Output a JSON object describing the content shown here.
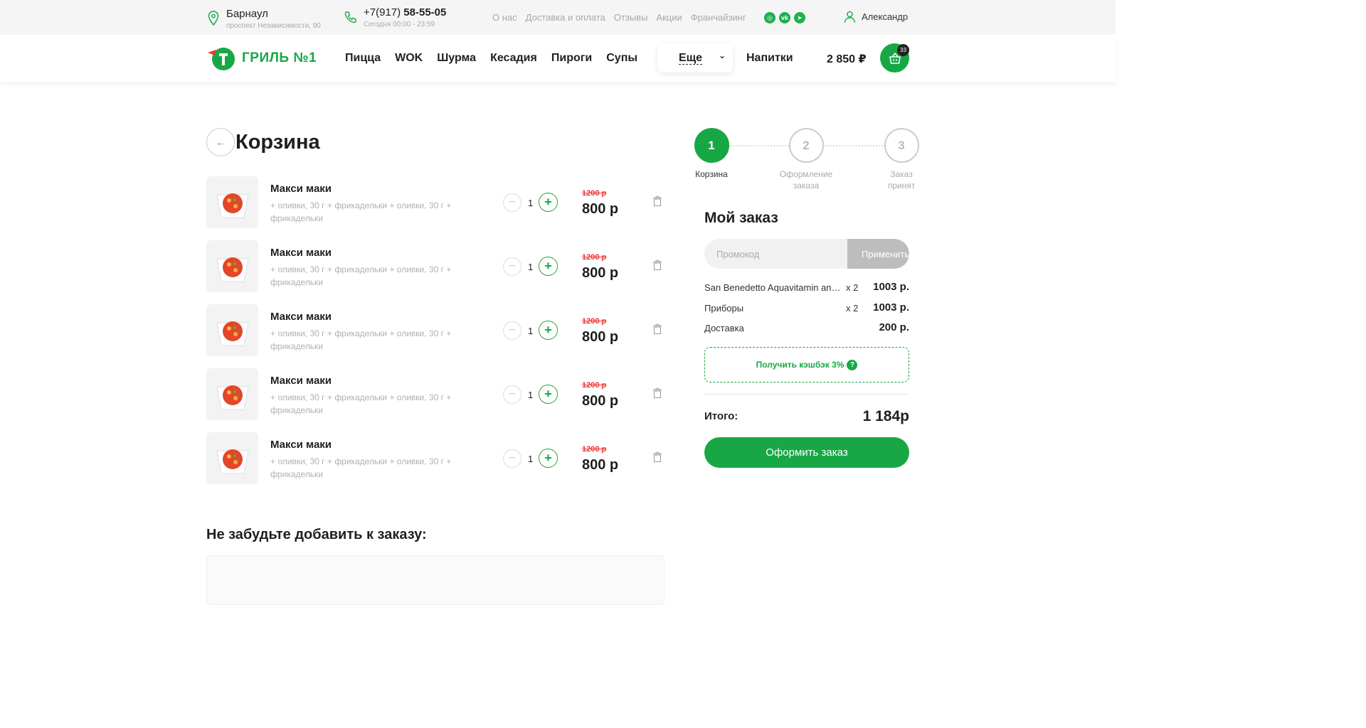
{
  "topbar": {
    "city": "Барнаул",
    "address": "проспект Независимости, 90",
    "phone_prefix": "+7(917) ",
    "phone_main": "58-55-05",
    "hours": "Сегодня 00:00 - 23:59",
    "links": [
      "О нас",
      "Доставка и оплата",
      "Отзывы",
      "Акции",
      "Франчайзинг"
    ],
    "user_name": "Александр"
  },
  "header": {
    "logo_text": "ГРИЛЬ №1",
    "nav": [
      "Пицца",
      "WOK",
      "Шурма",
      "Кесадия",
      "Пироги",
      "Супы"
    ],
    "more_label": "Еще",
    "drinks_label": "Напитки",
    "cart_total": "2 850 ₽",
    "cart_count": "33",
    "accent": "#17a845"
  },
  "cart": {
    "title": "Корзина",
    "items": [
      {
        "name": "Макси маки",
        "desc": "+ оливки, 30 г + фрикадельки + оливки, 30 г + фрикадельки",
        "qty": "1",
        "old_price": "1200 р",
        "price": "800 р"
      },
      {
        "name": "Макси маки",
        "desc": "+ оливки, 30 г + фрикадельки + оливки, 30 г + фрикадельки",
        "qty": "1",
        "old_price": "1200 р",
        "price": "800 р"
      },
      {
        "name": "Макси маки",
        "desc": "+ оливки, 30 г + фрикадельки + оливки, 30 г + фрикадельки",
        "qty": "1",
        "old_price": "1200 р",
        "price": "800 р"
      },
      {
        "name": "Макси маки",
        "desc": "+ оливки, 30 г + фрикадельки + оливки, 30 г + фрикадельки",
        "qty": "1",
        "old_price": "1200 р",
        "price": "800 р"
      },
      {
        "name": "Макси маки",
        "desc": "+ оливки, 30 г + фрикадельки + оливки, 30 г + фрикадельки",
        "qty": "1",
        "old_price": "1200 р",
        "price": "800 р"
      }
    ],
    "suggest_title": "Не забудьте добавить к заказу:"
  },
  "steps": [
    {
      "num": "1",
      "label": "Корзина"
    },
    {
      "num": "2",
      "label": "Оформление заказа"
    },
    {
      "num": "3",
      "label": "Заказ принят"
    }
  ],
  "order": {
    "title": "Мой заказ",
    "promo_placeholder": "Промокод",
    "apply_label": "Применить",
    "rows": [
      {
        "name": "San Benedetto Aquavitamin antiox",
        "mult": "x 2",
        "price": "1003 р."
      },
      {
        "name": "Приборы",
        "mult": "x 2",
        "price": "1003 р."
      },
      {
        "name": "Доставка",
        "mult": "",
        "price": "200 р."
      }
    ],
    "cashback_label": "Получить кэшбэк 3%",
    "total_label": "Итого:",
    "total_value": "1 184р",
    "checkout_label": "Оформить заказ"
  }
}
